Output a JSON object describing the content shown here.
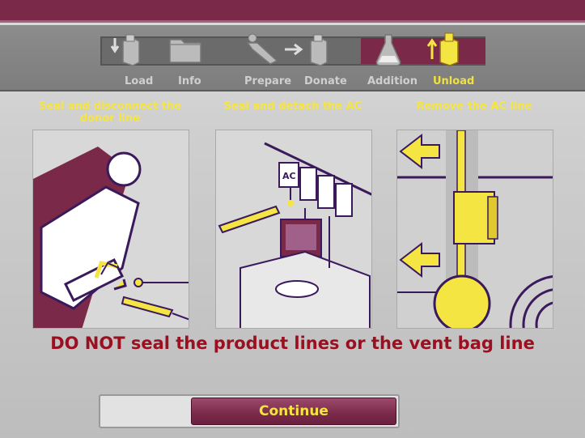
{
  "steps": [
    {
      "label": "Load",
      "icon": "load-icon",
      "active": false
    },
    {
      "label": "Info",
      "icon": "info-folder-icon",
      "active": false
    },
    {
      "label": "Prepare",
      "icon": "prepare-donor-icon",
      "active": false
    },
    {
      "label": "Donate",
      "icon": "donate-arrow-icon",
      "active": false
    },
    {
      "label": "Addition",
      "icon": "addition-flask-icon",
      "active": false
    },
    {
      "label": "Unload",
      "icon": "unload-icon",
      "active": true
    }
  ],
  "panels": [
    {
      "title": "Seal and disconnect the donor line",
      "illustration": "donor-line-illustration"
    },
    {
      "title": "Seal and detach the AC",
      "illustration": "ac-detach-illustration"
    },
    {
      "title": "Remove the AC line",
      "illustration": "remove-ac-line-illustration"
    }
  ],
  "warning": "DO NOT seal the product lines or the vent bag line",
  "continue_label": "Continue",
  "colors": {
    "accent": "#7a2a48",
    "highlight": "#f5e542",
    "warning": "#9a1020",
    "outline": "#3a1a5a"
  }
}
